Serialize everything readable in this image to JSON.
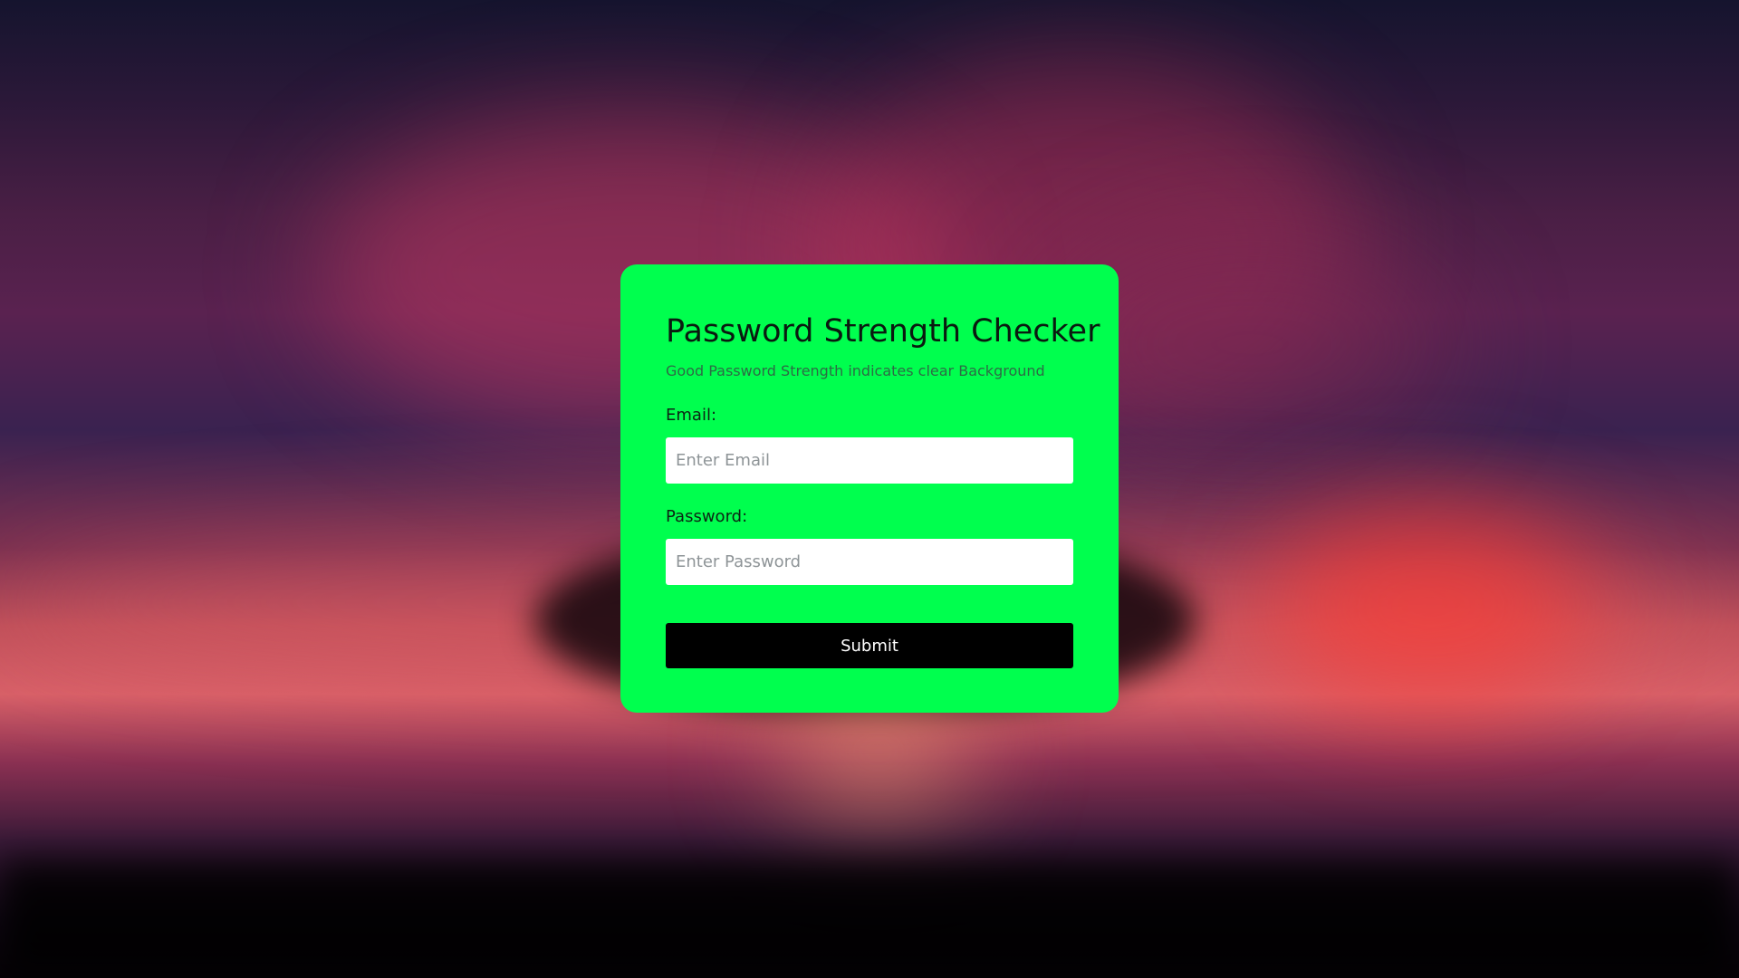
{
  "form": {
    "title": "Password Strength Checker",
    "subtitle": "Good Password Strength indicates clear Background",
    "email_label": "Email:",
    "email_placeholder": "Enter Email",
    "email_value": "",
    "password_label": "Password:",
    "password_placeholder": "Enter Password",
    "password_value": "",
    "submit_label": "Submit"
  },
  "colors": {
    "card_background": "#00ff4e",
    "button_background": "#000000",
    "button_text": "#ffffff"
  }
}
